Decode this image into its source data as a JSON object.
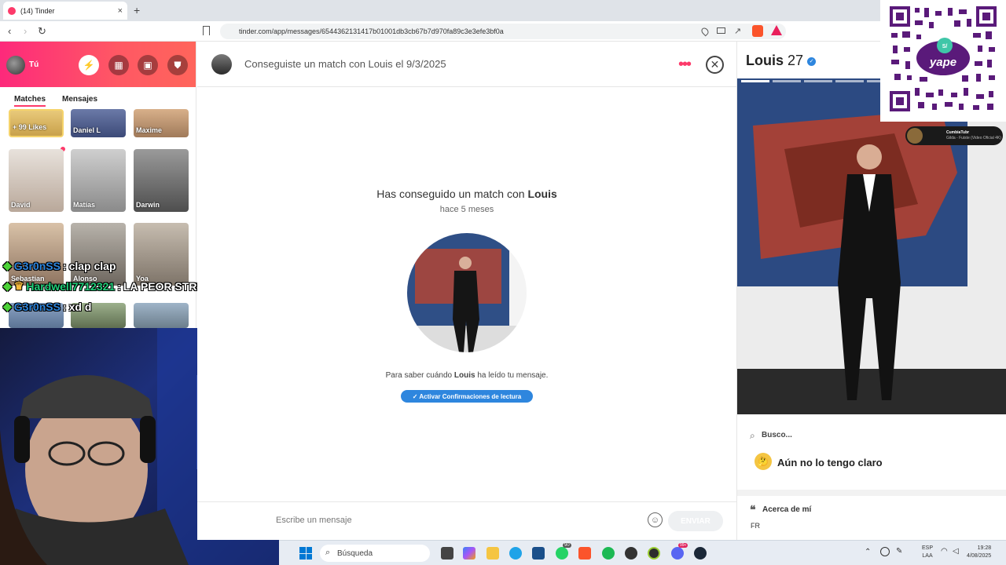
{
  "browser": {
    "tab_title": "(14) Tinder",
    "tab_close": "×",
    "new_tab": "+",
    "back": "‹",
    "forward": "›",
    "reload": "↻",
    "url": "tinder.com/app/messages/6544362131417b01001db3cb67b7d970fa89c3e3efe3bf0a"
  },
  "sidebar": {
    "user_label": "Tú",
    "tabs": [
      "Matches",
      "Mensajes"
    ],
    "likes_label": "+ 99 Likes",
    "matches": [
      "Daniel L",
      "Maxime",
      "David",
      "Matías",
      "Darwin",
      "Sebastian",
      "Alonso",
      "Yoa"
    ]
  },
  "stream_chat": [
    {
      "user": "G3r0nSS",
      "sep": ":",
      "msg": "clap clap"
    },
    {
      "user": "Hardwell7712321",
      "sep": ":",
      "msg": "LA PEOR STRIMER"
    },
    {
      "user": "G3r0nSS",
      "sep": ":",
      "msg": "xd d"
    }
  ],
  "chat": {
    "header": "Conseguiste un match con Louis el 9/3/2025",
    "more_dots": "•••",
    "close": "✕",
    "match_prefix": "Has conseguido un match con ",
    "match_name": "Louis",
    "time_ago": "hace 5 meses",
    "read_prefix": "Para saber cuándo ",
    "read_name": "Louis",
    "read_suffix": " ha leído tu mensaje.",
    "activate_button": "✓ Activar Confirmaciones de lectura",
    "input_placeholder": "Escribe un mensaje",
    "send_button": "ENVIAR"
  },
  "profile": {
    "name": "Louis",
    "age": "27",
    "verified_icon": "✓",
    "busco_label": "Busco...",
    "busco_value": "Aún no lo tengo claro",
    "acerca_label": "Acerca de mí",
    "acerca_value": "FR"
  },
  "overlay": {
    "qr_brand": "yape",
    "qr_badge": "S/",
    "yt_channel": "CumbiaTubr",
    "yt_song": "Gilda - Fuiste (Video Oficial 4K)"
  },
  "taskbar": {
    "search_placeholder": "Búsqueda",
    "badge_whatsapp": "90",
    "badge_discord": "99+",
    "lang_1": "ESP",
    "lang_2": "LAA",
    "time": "19:28",
    "date": "4/08/2025"
  },
  "colors": {
    "brand_gradient_start": "#fd297b",
    "brand_gradient_end": "#ff655b",
    "accent_blue": "#2e86de"
  }
}
